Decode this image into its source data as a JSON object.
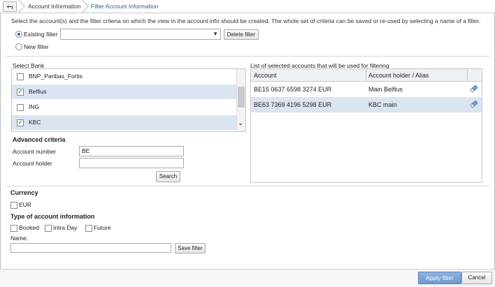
{
  "breadcrumb": {
    "back_glyph": "⮢",
    "items": [
      "Account Information",
      "Filter Account Information"
    ]
  },
  "intro": "Select the account(s) and the filter criteria on which the view in the account info should be created. The whole set of criteria can be saved or re-used by selecting a name of a filter.",
  "filter": {
    "existing_label": "Existing filter",
    "existing_selected": true,
    "new_label": "New filter",
    "dropdown_value": "",
    "delete_button": "Delete filter"
  },
  "banks": {
    "title": "Select Bank",
    "items": [
      {
        "name": "BNP_Paribas_Fortis",
        "checked": false
      },
      {
        "name": "Belfius",
        "checked": true
      },
      {
        "name": "ING",
        "checked": false
      },
      {
        "name": "KBC",
        "checked": true
      }
    ]
  },
  "advanced": {
    "title": "Advanced criteria",
    "account_number_label": "Account number",
    "account_number_value": "BE",
    "account_holder_label": "Account holder",
    "account_holder_value": "",
    "search_button": "Search"
  },
  "accounts": {
    "caption": "List of selected accounts that will be used for filtering",
    "columns": [
      "Account",
      "Account holder / Alias"
    ],
    "rows": [
      {
        "account": "BE15 0637 6598 3274 EUR",
        "holder": "Main Belfius",
        "icon": "eraser-icon"
      },
      {
        "account": "BE63 7369 4196 5298 EUR",
        "holder": "KBC main",
        "icon": "eraser-icon"
      }
    ]
  },
  "currency": {
    "title": "Currency",
    "options": [
      {
        "label": "EUR",
        "checked": false
      }
    ]
  },
  "types": {
    "title": "Type of account information",
    "options": [
      {
        "label": "Booked",
        "checked": false
      },
      {
        "label": "Intra Day",
        "checked": false
      },
      {
        "label": "Future",
        "checked": false
      }
    ]
  },
  "save": {
    "name_label": "Name:",
    "name_value": "",
    "button": "Save filter"
  },
  "footer": {
    "apply": "Apply filter",
    "cancel": "Cancel"
  },
  "colors": {
    "accent": "#6e98cf",
    "selected_row": "#dbe4f1",
    "link": "#2b5c8f"
  }
}
